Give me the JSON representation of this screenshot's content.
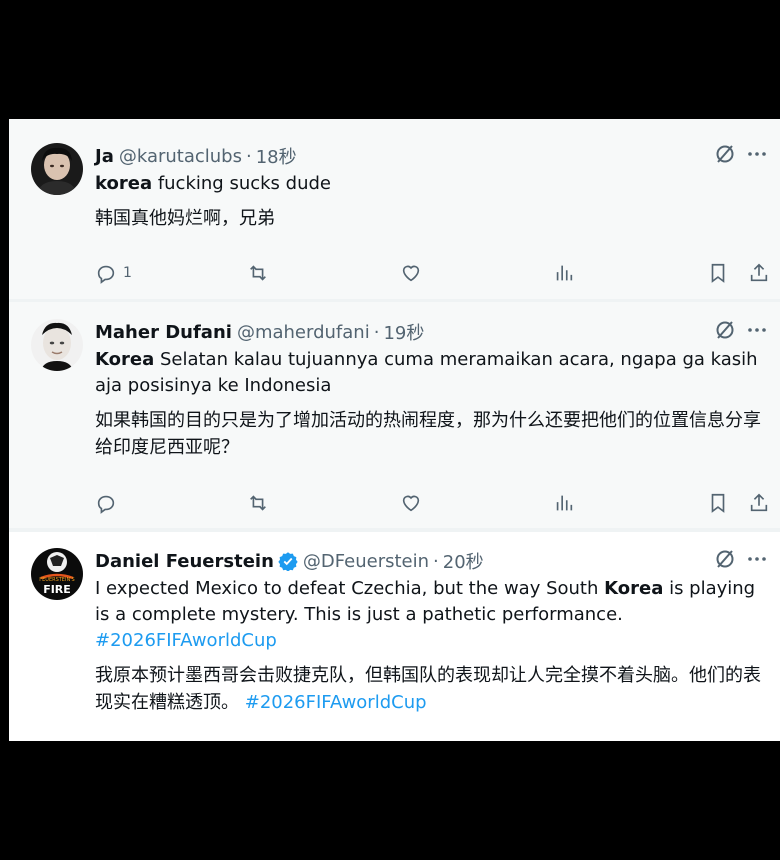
{
  "tweets": [
    {
      "name": "Ja",
      "handle": "@karutaclubs",
      "time": "18秒",
      "text_keyword": "korea",
      "text_rest": " fucking sucks dude",
      "translation": "韩国真他妈烂啊，兄弟",
      "reply_count": "1"
    },
    {
      "name": "Maher Dufani",
      "handle": "@maherdufani",
      "time": "19秒",
      "text_keyword": "Korea",
      "text_rest": " Selatan kalau tujuannya cuma meramaikan acara, ngapa ga kasih aja posisinya ke Indonesia",
      "translation": "如果韩国的目的只是为了增加活动的热闹程度，那为什么还要把他们的位置信息分享给印度尼西亚呢？",
      "reply_count": ""
    },
    {
      "name": "Daniel Feuerstein",
      "handle": "@DFeuerstein",
      "time": "20秒",
      "verified": true,
      "text_before": "I expected Mexico to defeat Czechia, but the way South ",
      "text_keyword": "Korea",
      "text_after": " is playing is a complete mystery. This is just a pathetic performance.",
      "hashtag": "#2026FIFAworldCup",
      "translation": "我原本预计墨西哥会击败捷克队，但韩国队的表现却让人完全摸不着头脑。他们的表现实在糟糕透顶。",
      "translation_hashtag": "#2026FIFAworldCup",
      "avatar_text_top": "FEUERSTEIN'S",
      "avatar_text_bottom": "FIRE"
    }
  ],
  "icons": [
    "grok-icon",
    "more-icon",
    "reply-icon",
    "retweet-icon",
    "like-icon",
    "views-icon",
    "bookmark-icon",
    "share-icon",
    "verified-badge-icon"
  ],
  "colors": {
    "accent": "#1d9bf0",
    "muted": "#536471",
    "text": "#0f1419",
    "background_hover": "#f7f9f9"
  }
}
